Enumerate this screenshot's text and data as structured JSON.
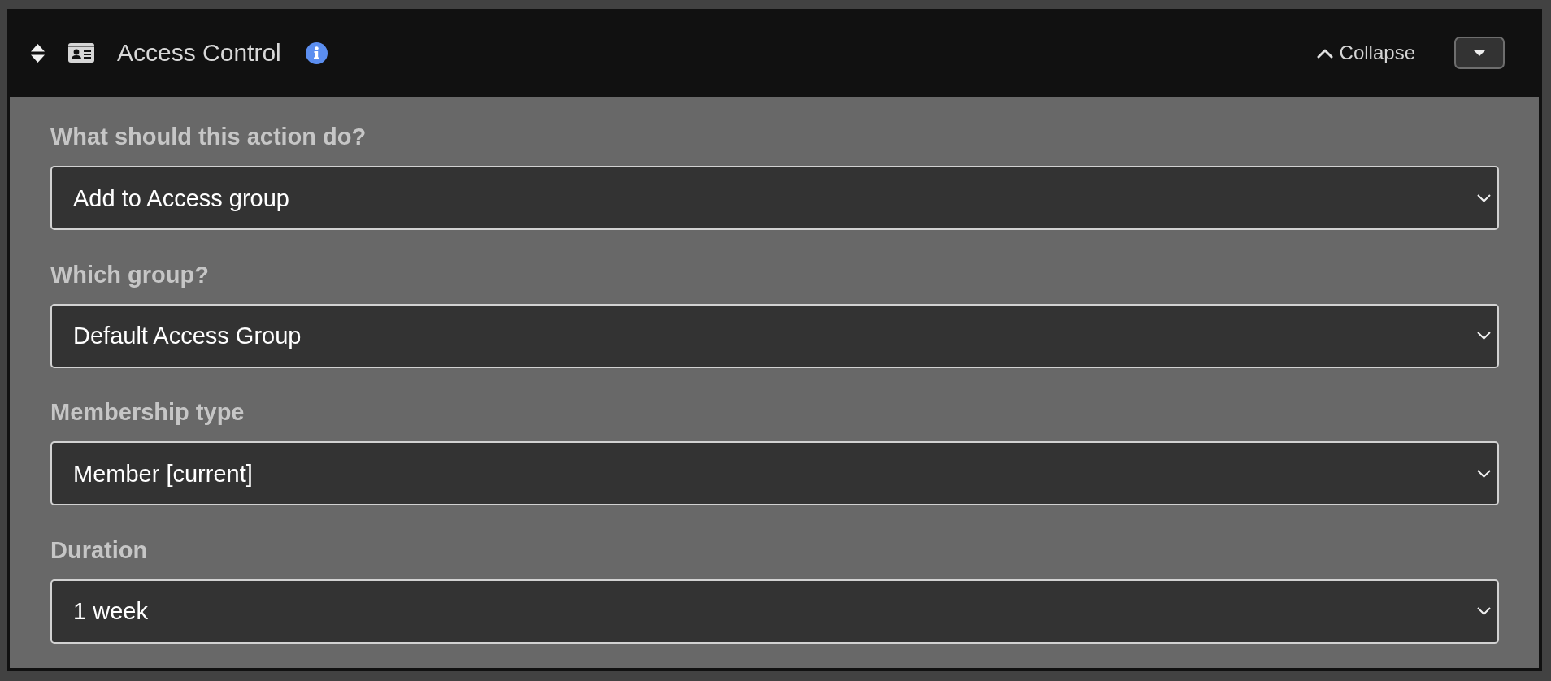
{
  "header": {
    "title": "Access Control",
    "collapse_label": "Collapse"
  },
  "fields": [
    {
      "label": "What should this action do?",
      "value": "Add to Access group"
    },
    {
      "label": "Which group?",
      "value": "Default Access Group"
    },
    {
      "label": "Membership type",
      "value": "Member [current]"
    },
    {
      "label": "Duration",
      "value": "1 week"
    }
  ]
}
